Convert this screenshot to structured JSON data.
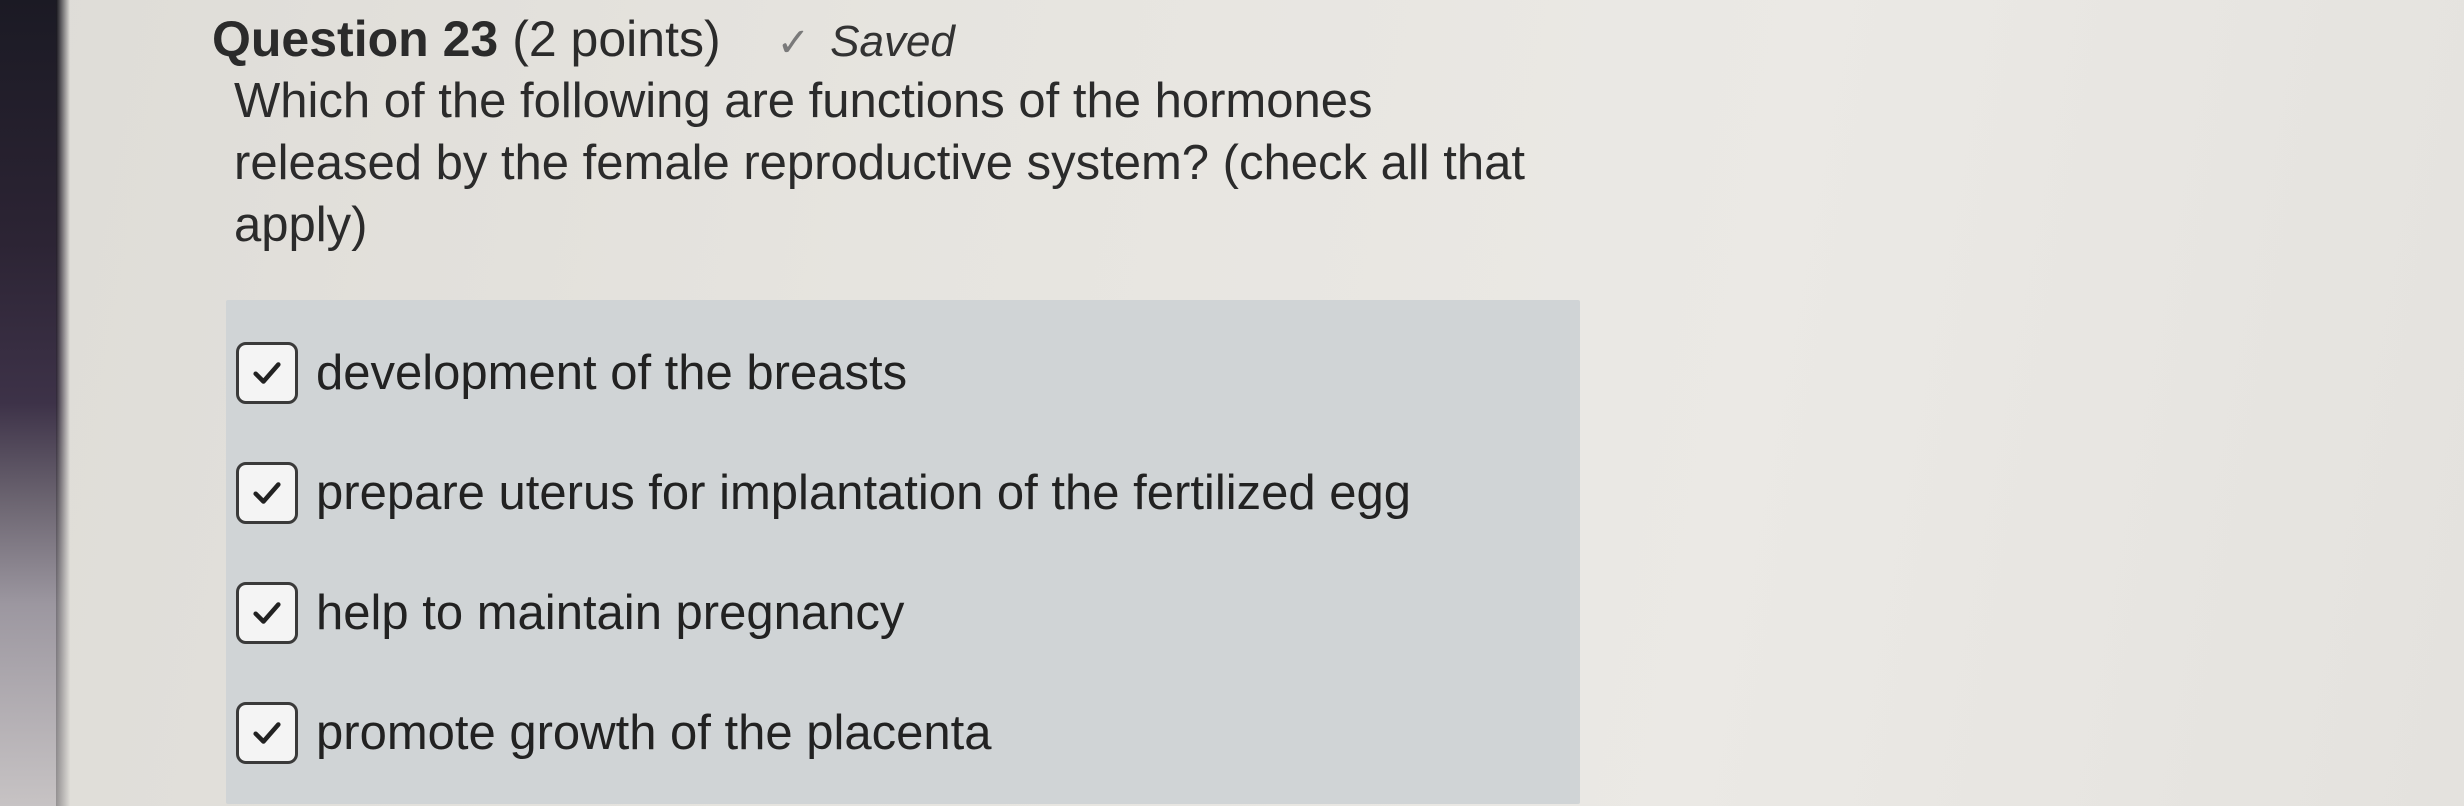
{
  "question": {
    "title": "Question 23",
    "points": "(2 points)",
    "saved_text": "Saved",
    "saved_icon": "check-icon",
    "prompt": "Which of the following are functions of the hormones released by the female reproductive system? (check all that apply)"
  },
  "answers": [
    {
      "label": "development of the breasts",
      "checked": true
    },
    {
      "label": "prepare uterus for implantation of the fertilized egg",
      "checked": true
    },
    {
      "label": "help to maintain pregnancy",
      "checked": true
    },
    {
      "label": "promote growth of the placenta",
      "checked": true
    }
  ],
  "colors": {
    "answers_background": "#d0d4d6",
    "checkbox_border": "#3a3a3a",
    "text": "#222222"
  }
}
